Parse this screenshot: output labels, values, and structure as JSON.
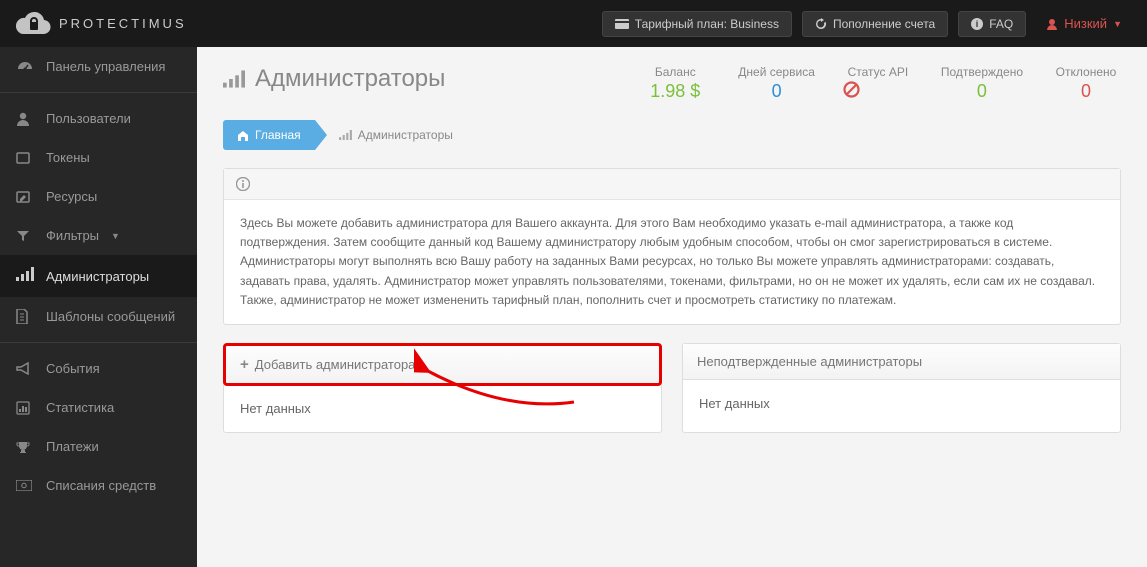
{
  "topbar": {
    "brand": "PROTECTIMUS",
    "tariff_label": "Тарифный план: Business",
    "topup_label": "Пополнение счета",
    "faq_label": "FAQ",
    "user_label": "Низкий"
  },
  "sidebar": {
    "dashboard": "Панель управления",
    "users": "Пользователи",
    "tokens": "Токены",
    "resources": "Ресурсы",
    "filters": "Фильтры",
    "admins": "Администраторы",
    "templates": "Шаблоны сообщений",
    "events": "События",
    "stats": "Статистика",
    "payments": "Платежи",
    "writeoffs": "Списания средств"
  },
  "page": {
    "title": "Администраторы",
    "balance_label": "Баланс",
    "balance_value": "1.98 $",
    "days_label": "Дней сервиса",
    "days_value": "0",
    "api_label": "Статус API",
    "confirmed_label": "Подтверждено",
    "confirmed_value": "0",
    "declined_label": "Отклонено",
    "declined_value": "0"
  },
  "crumbs": {
    "home": "Главная",
    "current": "Администраторы"
  },
  "info": {
    "text": "Здесь Вы можете добавить администратора для Вашего аккаунта. Для этого Вам необходимо указать e-mail администратора, а также код подтверждения. Затем сообщите данный код Вашему администратору любым удобным способом, чтобы он смог зарегистрироваться в системе. Администраторы могут выполнять всю Вашу работу на заданных Вами ресурсах, но только Вы можете управлять администраторами: создавать, задавать права, удалять. Администратор может управлять пользователями, токенами, фильтрами, но он не может их удалять, если сам их не создавал. Также, администратор не может измененить тарифный план, пополнить счет и просмотреть статистику по платежам."
  },
  "panels": {
    "add_admin": "Добавить администратора",
    "unconfirmed": "Неподтвержденные администраторы",
    "nodata": "Нет данных"
  }
}
